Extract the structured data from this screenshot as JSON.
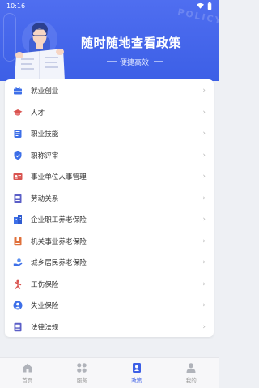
{
  "status_bar": {
    "time": "10:16"
  },
  "banner": {
    "title": "随时随地查看政策",
    "subtitle": "便捷高效",
    "decor_text": "POLICY"
  },
  "colors": {
    "primary": "#3c5fe6",
    "banner_start": "#4f6ef0",
    "background": "#eef0f4"
  },
  "list": {
    "items": [
      {
        "label": "就业创业",
        "icon": "briefcase-icon",
        "color": "#3d6fe8"
      },
      {
        "label": "人才",
        "icon": "graduation-cap-icon",
        "color": "#d9534f"
      },
      {
        "label": "职业技能",
        "icon": "badge-icon",
        "color": "#3d6fe8"
      },
      {
        "label": "职称评审",
        "icon": "shield-check-icon",
        "color": "#3d6fe8"
      },
      {
        "label": "事业单位人事管理",
        "icon": "id-card-icon",
        "color": "#d9534f"
      },
      {
        "label": "劳动关系",
        "icon": "document-icon",
        "color": "#5b5fc7"
      },
      {
        "label": "企业职工养老保险",
        "icon": "building-icon",
        "color": "#3d6fe8"
      },
      {
        "label": "机关事业养老保险",
        "icon": "bookmark-doc-icon",
        "color": "#e0703a"
      },
      {
        "label": "城乡居民养老保险",
        "icon": "hand-icon",
        "color": "#3d6fe8"
      },
      {
        "label": "工伤保险",
        "icon": "injured-person-icon",
        "color": "#d9534f"
      },
      {
        "label": "失业保险",
        "icon": "person-circle-icon",
        "color": "#3d6fe8"
      },
      {
        "label": "法律法规",
        "icon": "law-book-icon",
        "color": "#5b5fc7"
      }
    ]
  },
  "tabbar": {
    "tabs": [
      {
        "label": "首页",
        "icon": "home-icon"
      },
      {
        "label": "服务",
        "icon": "grid-icon"
      },
      {
        "label": "政策",
        "icon": "policy-icon",
        "active": true
      },
      {
        "label": "我的",
        "icon": "profile-icon"
      }
    ]
  }
}
